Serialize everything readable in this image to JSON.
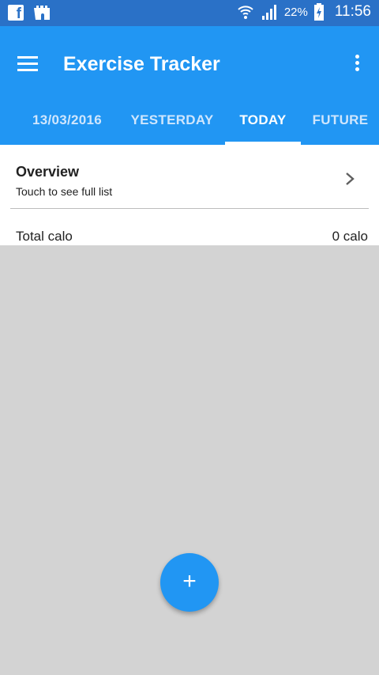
{
  "status_bar": {
    "battery_percent": "22%",
    "time": "11:56",
    "icons": [
      "facebook-icon",
      "castle-icon",
      "wifi-icon",
      "signal-icon",
      "battery-charging-icon"
    ]
  },
  "app_bar": {
    "title": "Exercise Tracker",
    "menu_icon": "hamburger-menu-icon",
    "overflow_icon": "more-vert-icon"
  },
  "tabs": [
    {
      "label": "13/03/2016",
      "active": false
    },
    {
      "label": "YESTERDAY",
      "active": false
    },
    {
      "label": "TODAY",
      "active": true
    },
    {
      "label": "FUTURE",
      "active": false
    }
  ],
  "overview": {
    "title": "Overview",
    "subtitle": "Touch to see full list",
    "chevron_icon": "chevron-right-icon"
  },
  "summary": {
    "total_label": "Total calo",
    "total_value": "0 calo"
  },
  "fab": {
    "label": "+",
    "icon": "add-icon"
  },
  "colors": {
    "status_bar": "#2a71c7",
    "primary": "#2196f3",
    "background": "#d3d3d3"
  }
}
